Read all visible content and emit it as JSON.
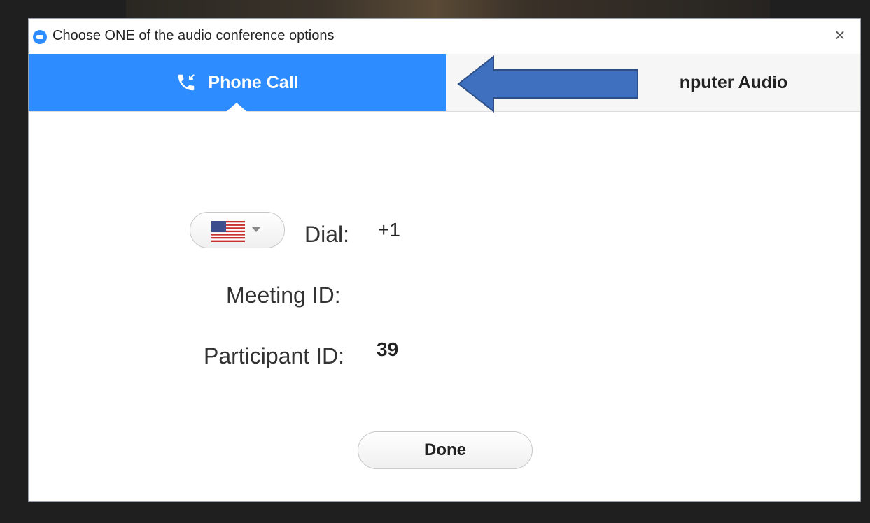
{
  "window": {
    "title": "Choose ONE of the audio conference options",
    "close_symbol": "×",
    "logo_icon": "zoom-logo-icon"
  },
  "tabs": [
    {
      "label": "Phone Call",
      "icon": "phone-call-icon",
      "active": true
    },
    {
      "label": "Computer Audio",
      "visible_label": "nputer Audio",
      "active": false
    }
  ],
  "annotation": {
    "icon": "blue-arrow-left",
    "color": "#3f6fbf"
  },
  "phone": {
    "country_flag": "us-flag-icon",
    "dial_label": "Dial:",
    "dial_value": "+1",
    "meeting_id_label": "Meeting ID:",
    "meeting_id_value": "",
    "participant_id_label": "Participant ID:",
    "participant_id_value": "39"
  },
  "footer": {
    "done_label": "Done"
  },
  "colors": {
    "accent": "#2d8cff",
    "tab_inactive": "#f6f6f6"
  }
}
